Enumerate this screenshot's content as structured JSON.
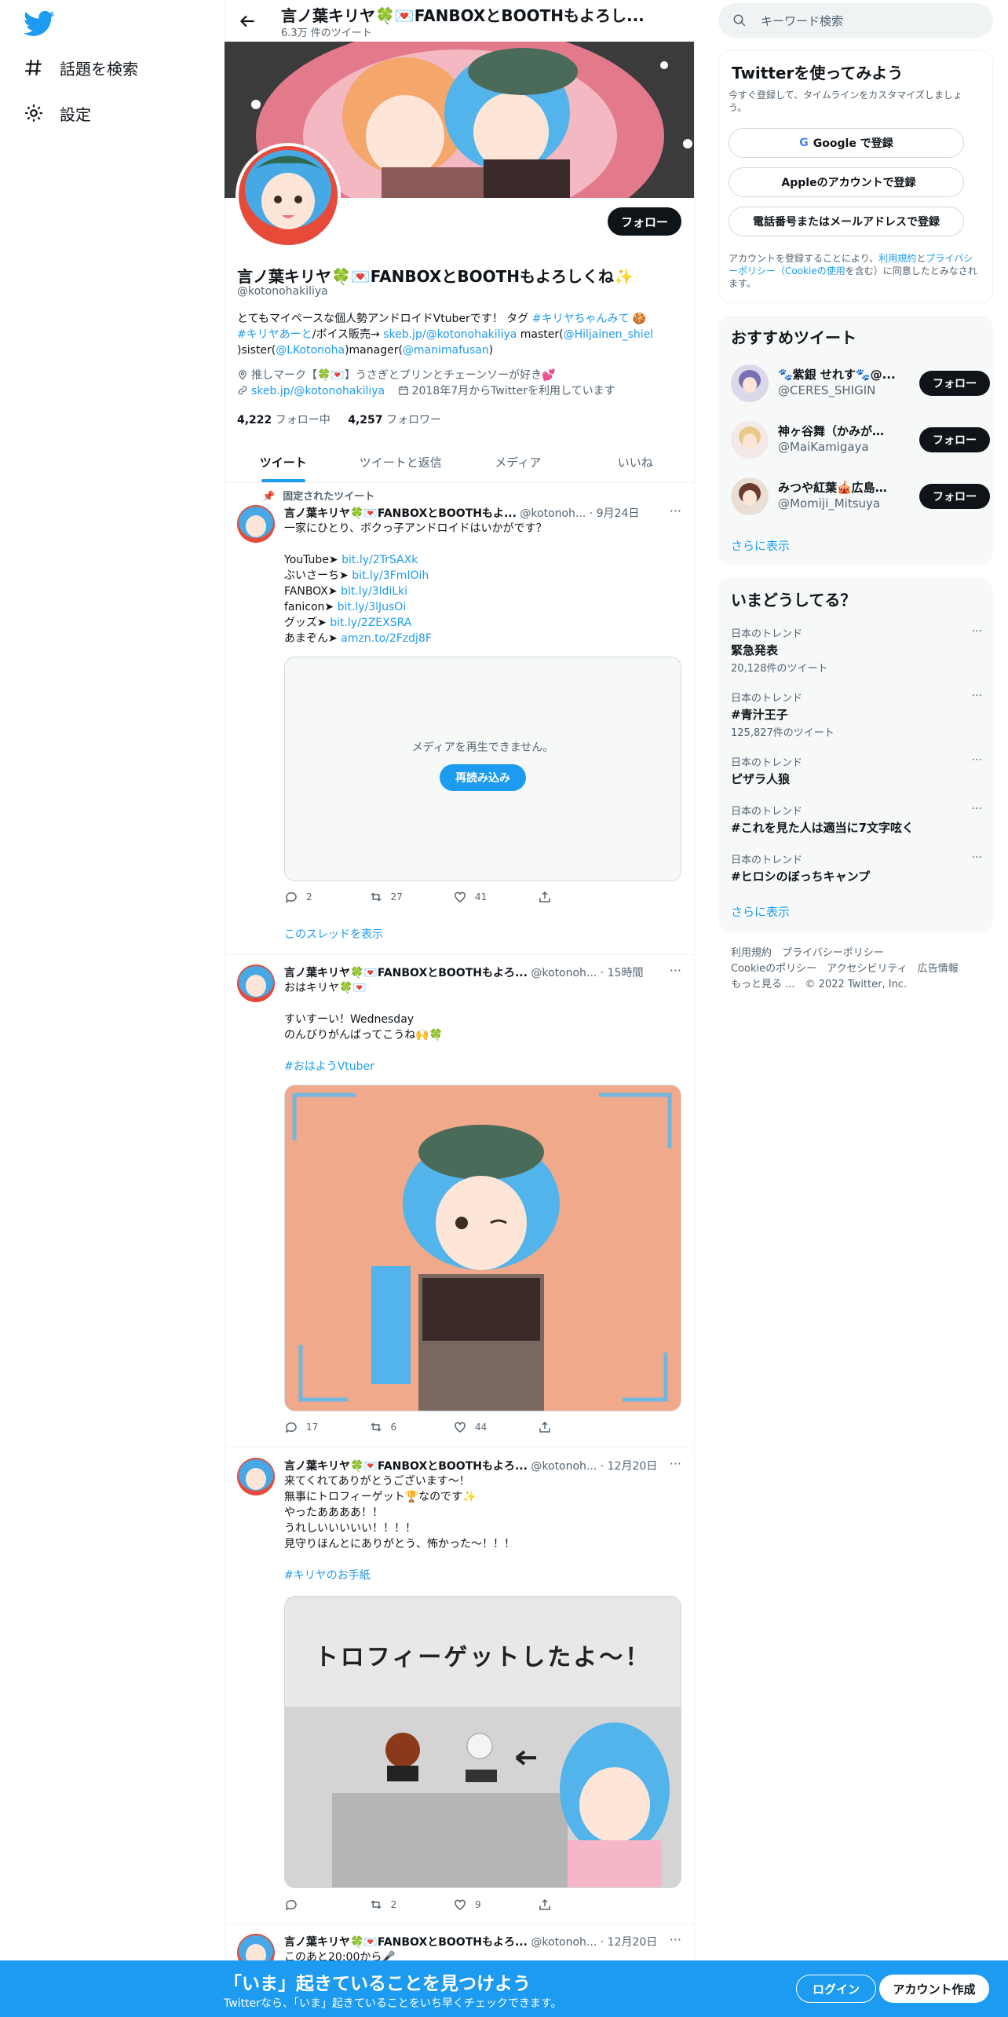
{
  "nav": {
    "explore_label": "話題を検索",
    "settings_label": "設定"
  },
  "header": {
    "title": "言ノ葉キリヤ🍀💌FANBOXとBOOTHもよろし...",
    "tweet_count": "6.3万 件のツイート"
  },
  "profile": {
    "follow_label": "フォロー",
    "name": "言ノ葉キリヤ🍀💌FANBOXとBOOTHもよろしくね✨",
    "handle": "@kotonohakiliya",
    "bio_1": "とてもマイペースな個人勢アンドロイドVtuberです！ タグ ",
    "bio_tag1": "#キリヤちゃんみて",
    "bio_2": " 🍪",
    "bio_tag2": "#キリヤあーと",
    "bio_3": "/ボイス販売→ ",
    "bio_link1": "skeb.jp/@kotonohakiliya",
    "bio_4": " master(",
    "bio_link2": "@Hiljainen_shiel",
    "bio_5": ")sister(",
    "bio_link3": "@LKotonoha",
    "bio_6": ")manager(",
    "bio_link4": "@manimafusan",
    "bio_7": ")",
    "location": "推しマーク【🍀💌】うさぎとプリンとチェーンソーが好き💕",
    "url": "skeb.jp/@kotonohakiliya",
    "joined": "2018年7月からTwitterを利用しています",
    "following_count": "4,222",
    "following_label": " フォロー中",
    "followers_count": "4,257",
    "followers_label": " フォロワー"
  },
  "tabs": [
    "ツイート",
    "ツイートと返信",
    "メディア",
    "いいね"
  ],
  "tweets": [
    {
      "pinned_label": "固定されたツイート",
      "name": "言ノ葉キリヤ🍀💌FANBOXとBOOTHもよ...",
      "handle": "@kotonoh...",
      "time": "· 9月24日",
      "text_1": "一家にひとり、ボクっ子アンドロイドはいかがです？",
      "links": [
        {
          "label": "YouTube➤ ",
          "url": "bit.ly/2TrSAXk"
        },
        {
          "label": "ぶいさーち➤ ",
          "url": "bit.ly/3FmIOih"
        },
        {
          "label": "FANBOX➤ ",
          "url": "bit.ly/3ldiLki"
        },
        {
          "label": "fanicon➤ ",
          "url": "bit.ly/3lJusOi"
        },
        {
          "label": "グッズ➤ ",
          "url": "bit.ly/2ZEXSRA"
        },
        {
          "label": "あまぞん➤ ",
          "url": "amzn.to/2Fzdj8F"
        }
      ],
      "media_error": "メディアを再生できません。",
      "reload_label": "再読み込み",
      "replies": "2",
      "retweets": "27",
      "likes": "41",
      "thread_label": "このスレッドを表示"
    },
    {
      "name": "言ノ葉キリヤ🍀💌FANBOXとBOOTHもよろ...",
      "handle": "@kotonoh...",
      "time": "· 15時間",
      "line1": "おはキリヤ🍀💌",
      "line2": "すいすーい！Wednesday",
      "line3": "のんびりがんばってこうね🙌🍀",
      "hashtag": "#おはようVtuber",
      "replies": "17",
      "retweets": "6",
      "likes": "44"
    },
    {
      "name": "言ノ葉キリヤ🍀💌FANBOXとBOOTHもよろ...",
      "handle": "@kotonoh...",
      "time": "· 12月20日",
      "line1": "来てくれてありがとうございます～！",
      "line2": "無事にトロフィーゲット🏆なのです✨",
      "line3": "やったああああ！！",
      "line4": "うれしいいいいい！！！！",
      "line5": "見守りほんとにありがとう、怖かった～！！！",
      "hashtag": "#キリヤのお手紙",
      "image_caption": "トロフィーゲットしたよ～！",
      "replies": "",
      "retweets": "2",
      "likes": "9"
    },
    {
      "name": "言ノ葉キリヤ🍀💌FANBOXとBOOTHもよろ...",
      "handle": "@kotonoh...",
      "time": "· 12月20日",
      "line1": "このあと20:00から🎤"
    }
  ],
  "right": {
    "search_placeholder": "キーワード検索",
    "signup": {
      "title": "Twitterを使ってみよう",
      "sub": "今すぐ登録して、タイムラインをカスタマイズしましょう。",
      "google": "Google で登録",
      "apple": "Appleのアカウントで登録",
      "phone": "電話番号またはメールアドレスで登録",
      "terms_1": "アカウントを登録することにより、",
      "terms_link1": "利用規約",
      "terms_2": "と",
      "terms_link2": "プライバシーポリシー（Cookieの使用",
      "terms_3": "を含む）に同意したとみなされます。"
    },
    "recommend": {
      "title": "おすすめツイート",
      "users": [
        {
          "name": "🐾紫銀 せれす🐾@...",
          "handle": "@CERES_SHIGIN"
        },
        {
          "name": "神ヶ谷舞（かみがや...",
          "handle": "@MaiKamigaya"
        },
        {
          "name": "みつや紅葉🎪広島紹...",
          "handle": "@Momiji_Mitsuya"
        }
      ],
      "follow_label": "フォロー",
      "more": "さらに表示"
    },
    "trends": {
      "title": "いまどうしてる？",
      "items": [
        {
          "cat": "日本のトレンド",
          "title": "緊急発表",
          "count": "20,128件のツイート"
        },
        {
          "cat": "日本のトレンド",
          "title": "#青汁王子",
          "count": "125,827件のツイート"
        },
        {
          "cat": "日本のトレンド",
          "title": "ピザラ人狼",
          "count": ""
        },
        {
          "cat": "日本のトレンド",
          "title": "#これを見た人は適当に7文字呟く",
          "count": ""
        },
        {
          "cat": "日本のトレンド",
          "title": "#ヒロシのぼっちキャンプ",
          "count": ""
        }
      ],
      "more": "さらに表示"
    },
    "footer": {
      "l1": "利用規約",
      "l2": "プライバシーポリシー",
      "l3": "Cookieのポリシー",
      "l4": "アクセシビリティ",
      "l5": "広告情報",
      "l6": "もっと見る ...",
      "l7": "© 2022 Twitter, Inc."
    }
  },
  "bottom": {
    "title": "「いま」起きていることを見つけよう",
    "sub": "Twitterなら、「いま」起きていることをいち早くチェックできます。",
    "login": "ログイン",
    "signup": "アカウント作成"
  },
  "colors": {
    "accent": "#1d9bf0",
    "text": "#0f1419",
    "muted": "#536471",
    "peach": "#f0a98a"
  }
}
